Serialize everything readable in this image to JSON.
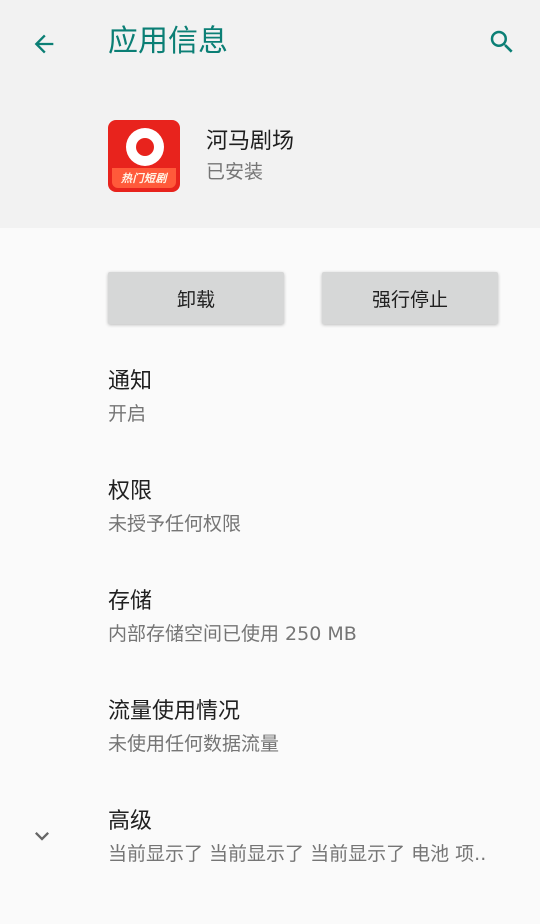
{
  "appbar": {
    "title": "应用信息",
    "back_icon": "arrow-back-icon",
    "search_icon": "search-icon",
    "accent": "#0b7f75"
  },
  "app": {
    "name": "河马剧场",
    "status": "已安装",
    "icon_badge": "热门短剧",
    "icon_color": "#e8231d"
  },
  "buttons": {
    "uninstall": "卸载",
    "force_stop": "强行停止"
  },
  "items": [
    {
      "label": "通知",
      "sub": "开启"
    },
    {
      "label": "权限",
      "sub": "未授予任何权限"
    },
    {
      "label": "存储",
      "sub": "内部存储空间已使用 250 MB"
    },
    {
      "label": "流量使用情况",
      "sub": "未使用任何数据流量"
    },
    {
      "label": "高级",
      "sub": "当前显示了 当前显示了 当前显示了 电池 项.."
    }
  ]
}
